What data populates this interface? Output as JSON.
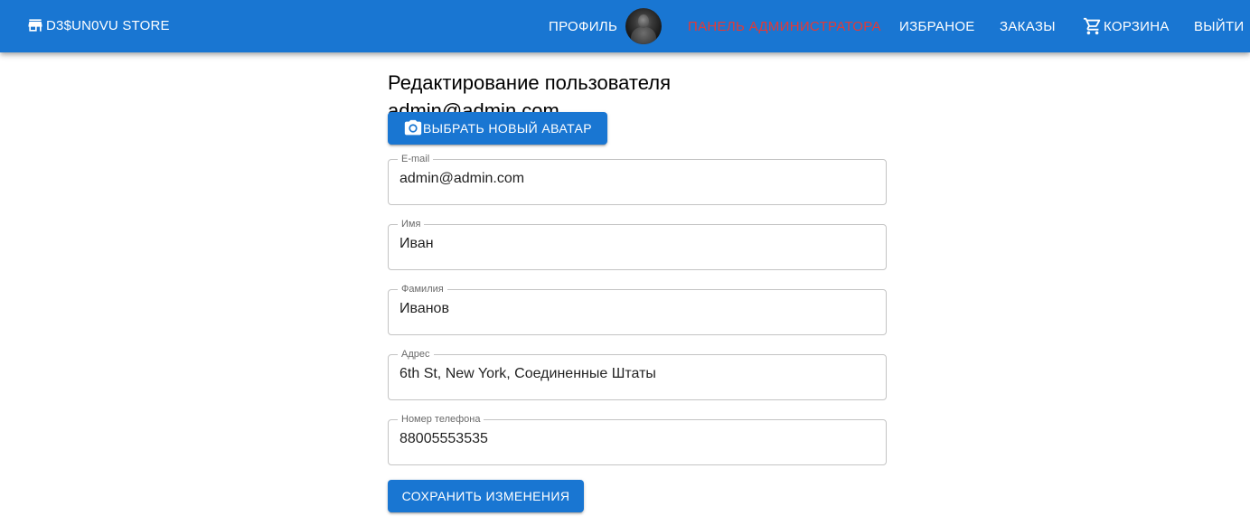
{
  "appbar": {
    "brand": "D3$UN0VU STORE",
    "nav": {
      "profile": "ПРОФИЛЬ",
      "admin_panel": "ПАНЕЛЬ АДМИНИСТРАТОРА",
      "favorites": "ИЗБРАНОЕ",
      "orders": "ЗАКАЗЫ",
      "cart": "КОРЗИНА",
      "logout": "ВЫЙТИ"
    },
    "colors": {
      "bar": "#1976d2",
      "admin_link": "#e53935"
    }
  },
  "page": {
    "title": "Редактирование пользователя",
    "subtitle": "admin@admin.com",
    "choose_avatar_button": "ВЫБРАТЬ НОВЫЙ АВАТАР",
    "save_button": "СОХРАНИТЬ ИЗМЕНЕНИЯ"
  },
  "form": {
    "email": {
      "label": "E-mail",
      "value": "admin@admin.com"
    },
    "first_name": {
      "label": "Имя",
      "value": "Иван"
    },
    "last_name": {
      "label": "Фамилия",
      "value": "Иванов"
    },
    "address": {
      "label": "Адрес",
      "value": "6th St, New York, Соединенные Штаты"
    },
    "phone": {
      "label": "Номер телефона",
      "value": "88005553535"
    }
  },
  "icons": {
    "brand": "storefront-icon",
    "cart": "shopping-cart-icon",
    "camera": "camera-icon"
  }
}
